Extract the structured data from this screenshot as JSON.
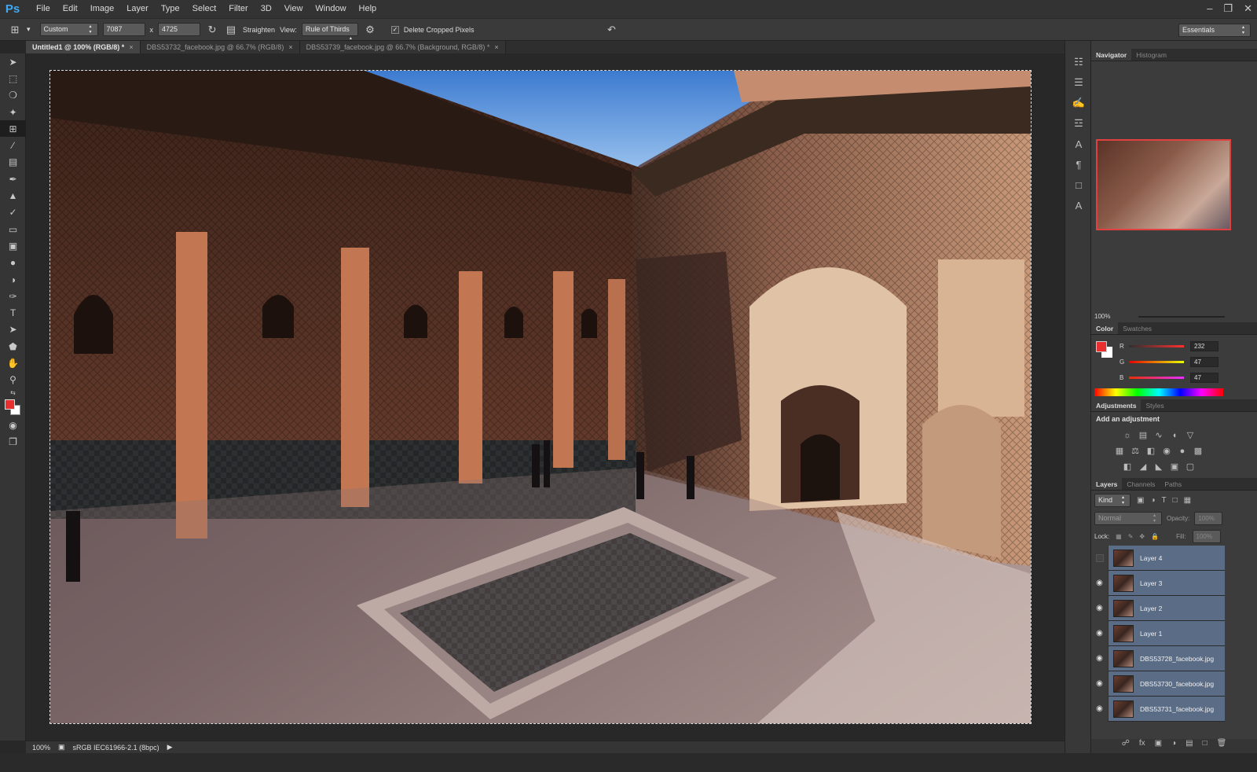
{
  "app": {
    "logo": "Ps"
  },
  "menu": [
    "File",
    "Edit",
    "Image",
    "Layer",
    "Type",
    "Select",
    "Filter",
    "3D",
    "View",
    "Window",
    "Help"
  ],
  "options": {
    "preset": "Custom",
    "width": "7087",
    "x_sep": "x",
    "height": "4725",
    "straighten": "Straighten",
    "view_label": "View:",
    "view_value": "Rule of Thirds",
    "delete_cropped": "Delete Cropped Pixels",
    "workspace": "Essentials"
  },
  "tabs": [
    {
      "label": "Untitled1 @ 100% (RGB/8) *",
      "active": true
    },
    {
      "label": "DBS53732_facebook.jpg @ 66.7% (RGB/8)",
      "active": false
    },
    {
      "label": "DBS53739_facebook.jpg @ 66.7% (Background, RGB/8) *",
      "active": false
    }
  ],
  "status": {
    "zoom": "100%",
    "profile": "sRGB IEC61966-2.1 (8bpc)"
  },
  "navigator": {
    "tabs": [
      "Navigator",
      "Histogram"
    ],
    "zoom": "100%"
  },
  "color": {
    "tabs": [
      "Color",
      "Swatches"
    ],
    "r_label": "R",
    "g_label": "G",
    "b_label": "B",
    "r": "232",
    "g": "47",
    "b": "47",
    "fg": "#e82f2f"
  },
  "adjustments": {
    "tabs": [
      "Adjustments",
      "Styles"
    ],
    "heading": "Add an adjustment"
  },
  "layers_panel": {
    "tabs": [
      "Layers",
      "Channels",
      "Paths"
    ],
    "kind": "Kind",
    "blend": "Normal",
    "opacity_label": "Opacity:",
    "opacity": "100%",
    "lock_label": "Lock:",
    "fill_label": "Fill:",
    "fill": "100%",
    "layers": [
      {
        "name": "Layer 4",
        "visible": false
      },
      {
        "name": "Layer 3",
        "visible": true
      },
      {
        "name": "Layer 2",
        "visible": true
      },
      {
        "name": "Layer 1",
        "visible": true
      },
      {
        "name": "DBS53728_facebook.jpg",
        "visible": true
      },
      {
        "name": "DBS53730_facebook.jpg",
        "visible": true
      },
      {
        "name": "DBS53731_facebook.jpg",
        "visible": true
      }
    ]
  }
}
